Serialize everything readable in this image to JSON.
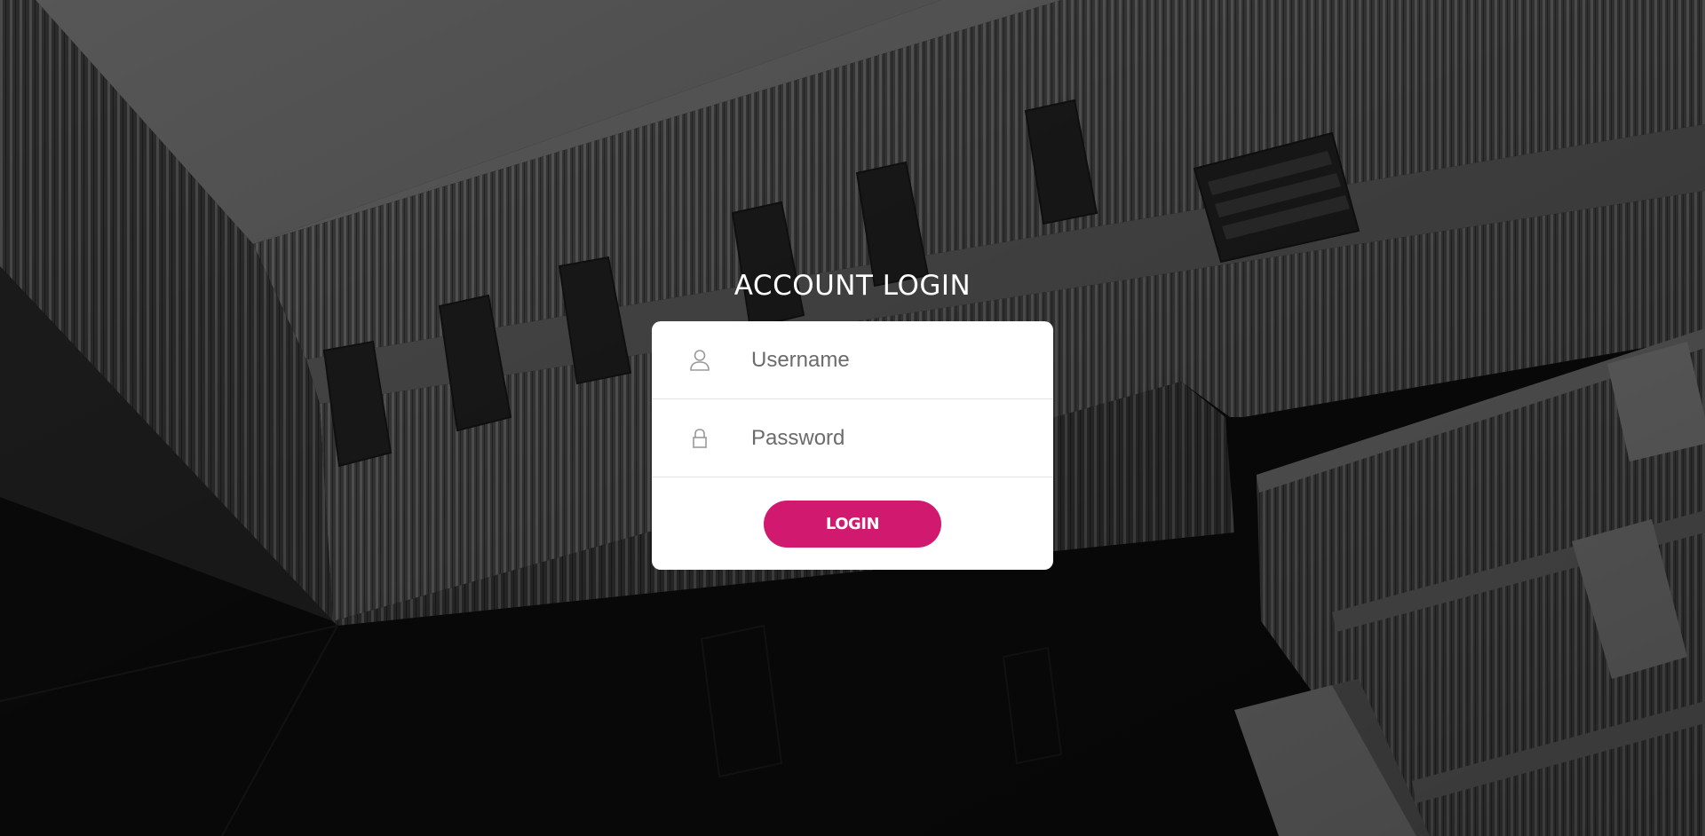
{
  "page": {
    "title": "ACCOUNT LOGIN"
  },
  "form": {
    "username": {
      "placeholder": "Username",
      "value": "",
      "icon": "user-icon"
    },
    "password": {
      "placeholder": "Password",
      "value": "",
      "icon": "lock-icon"
    },
    "login_label": "LOGIN"
  },
  "colors": {
    "accent": "#d11a6f",
    "card": "#ffffff",
    "background": "#0b0b0b"
  }
}
